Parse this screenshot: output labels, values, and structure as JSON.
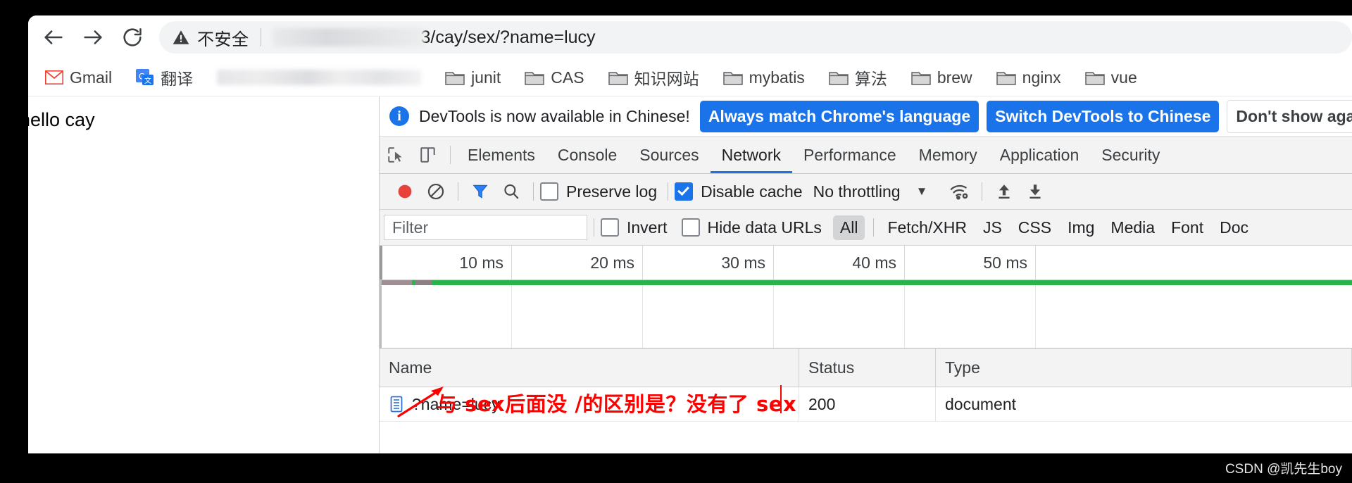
{
  "browser": {
    "nav": {
      "back": "back-arrow",
      "forward": "forward-arrow",
      "reload": "reload"
    },
    "omnibox": {
      "security_icon": "warning-triangle-icon",
      "security_label": "不安全",
      "url_visible": "3/cay/sex/?name=lucy"
    },
    "bookmarks": [
      {
        "icon": "gmail-icon",
        "label": "Gmail"
      },
      {
        "icon": "translate-icon",
        "label": "翻译"
      },
      {
        "icon": "redacted",
        "label": ""
      },
      {
        "icon": "folder-icon",
        "label": "junit"
      },
      {
        "icon": "folder-icon",
        "label": "CAS"
      },
      {
        "icon": "folder-icon",
        "label": "知识网站"
      },
      {
        "icon": "folder-icon",
        "label": "mybatis"
      },
      {
        "icon": "folder-icon",
        "label": "算法"
      },
      {
        "icon": "folder-icon",
        "label": "brew"
      },
      {
        "icon": "folder-icon",
        "label": "nginx"
      },
      {
        "icon": "folder-icon",
        "label": "vue"
      }
    ]
  },
  "page": {
    "body_text": "hello cay"
  },
  "devtools": {
    "banner": {
      "icon": "info-icon",
      "message": "DevTools is now available in Chinese!",
      "primary_button": "Always match Chrome's language",
      "secondary_button": "Switch DevTools to Chinese",
      "dismiss_button": "Don't show again"
    },
    "tools": {
      "inspect_icon": "inspect-cursor-icon",
      "device_icon": "device-toolbar-icon"
    },
    "tabs": [
      {
        "label": "Elements",
        "active": false
      },
      {
        "label": "Console",
        "active": false
      },
      {
        "label": "Sources",
        "active": false
      },
      {
        "label": "Network",
        "active": true
      },
      {
        "label": "Performance",
        "active": false
      },
      {
        "label": "Memory",
        "active": false
      },
      {
        "label": "Application",
        "active": false
      },
      {
        "label": "Security",
        "active": false
      }
    ],
    "network_toolbar": {
      "record_icon": "record-stop-icon",
      "clear_icon": "clear-no-entry-icon",
      "filter_icon": "funnel-filter-icon",
      "search_icon": "search-magnifier-icon",
      "preserve_log_label": "Preserve log",
      "preserve_log_checked": false,
      "disable_cache_label": "Disable cache",
      "disable_cache_checked": true,
      "throttling_value": "No throttling",
      "throttling_caret": "▼",
      "wifi_icon": "network-conditions-wifi-icon",
      "import_icon": "import-har-up-arrow-icon",
      "export_icon": "export-har-down-arrow-icon"
    },
    "filter_row": {
      "filter_placeholder": "Filter",
      "invert_label": "Invert",
      "invert_checked": false,
      "hide_data_urls_label": "Hide data URLs",
      "hide_data_urls_checked": false,
      "types": [
        {
          "label": "All",
          "active": true
        },
        {
          "label": "Fetch/XHR",
          "active": false
        },
        {
          "label": "JS",
          "active": false
        },
        {
          "label": "CSS",
          "active": false
        },
        {
          "label": "Img",
          "active": false
        },
        {
          "label": "Media",
          "active": false
        },
        {
          "label": "Font",
          "active": false
        },
        {
          "label": "Doc",
          "active": false
        }
      ]
    },
    "overview": {
      "ticks": [
        "10 ms",
        "20 ms",
        "30 ms",
        "40 ms",
        "50 ms"
      ]
    },
    "table": {
      "columns": [
        "Name",
        "Status",
        "Type"
      ],
      "rows": [
        {
          "icon": "document-icon",
          "name": "?name=lucy",
          "status": "200",
          "type": "document"
        }
      ]
    }
  },
  "annotation": {
    "text": "与 sex后面没 /的区别是？没有了 sex",
    "color": "#ff0000",
    "arrow_icon": "red-arrow-icon"
  },
  "watermark": {
    "text": "CSDN @凯先生boy"
  }
}
